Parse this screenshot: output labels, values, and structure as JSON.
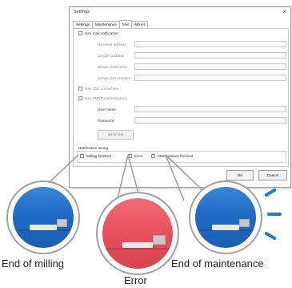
{
  "dialog": {
    "title": "Settings",
    "close_glyph": "×",
    "tabs": [
      {
        "label": "Settings",
        "active": false
      },
      {
        "label": "Maintenance",
        "active": false
      },
      {
        "label": "Mail",
        "active": true
      },
      {
        "label": "Milnet",
        "active": false
      }
    ],
    "use_mail_notification": {
      "label": "Use mail notification",
      "checked": false
    },
    "fields": [
      {
        "label": "Receiver address",
        "value": ""
      },
      {
        "label": "Sender address",
        "value": ""
      },
      {
        "label": "Server host name",
        "value": ""
      },
      {
        "label": "Server port number",
        "value": ""
      }
    ],
    "use_ssl": {
      "label": "Use SSL connection",
      "checked": false
    },
    "use_smtp_auth": {
      "label": "Use SMTP authentication",
      "checked": false
    },
    "auth_fields": [
      {
        "label": "User name",
        "value": ""
      },
      {
        "label": "Password",
        "value": ""
      }
    ],
    "send_test_label": "Send test",
    "notification_timing": {
      "label": "Notification timing",
      "options": [
        {
          "label": "Milling finished",
          "checked": true
        },
        {
          "label": "Error",
          "checked": true
        },
        {
          "label": "Maintenance finished",
          "checked": true
        }
      ]
    },
    "ok_label": "OK",
    "cancel_label": "Cancel"
  },
  "callouts": [
    {
      "caption": "End of milling",
      "state": "normal",
      "color": "#1f6bc4"
    },
    {
      "caption": "Error",
      "state": "error",
      "color": "#e9525d"
    },
    {
      "caption": "End of maintenance",
      "state": "normal",
      "color": "#1f6bc4"
    }
  ],
  "colors": {
    "accent_blue": "#1f7fc9",
    "error_red": "#e9525d",
    "circle_border": "#a0a0a0"
  }
}
